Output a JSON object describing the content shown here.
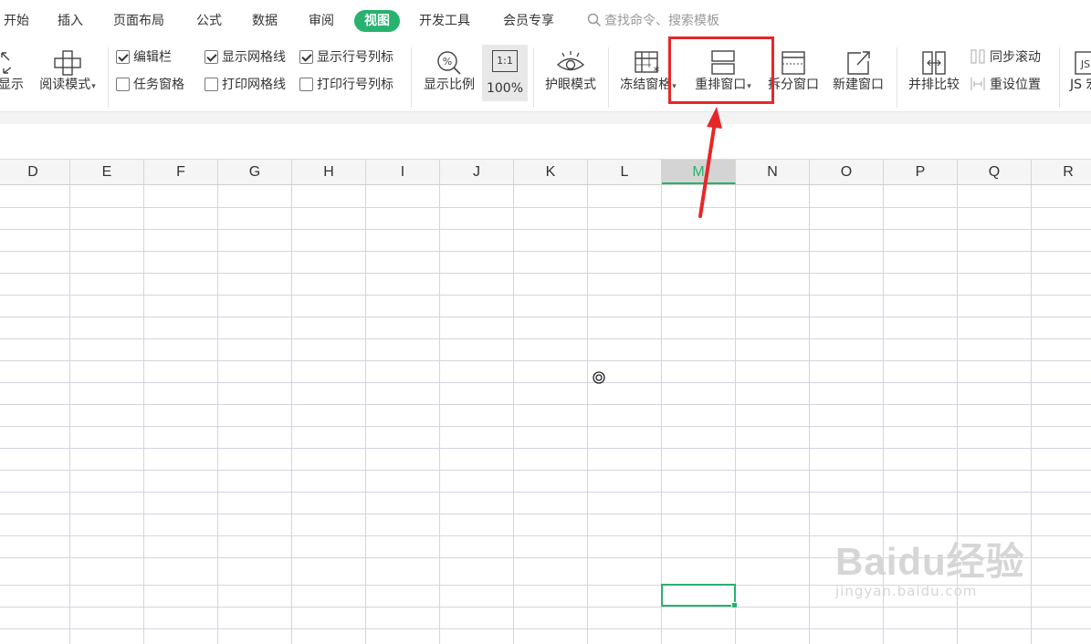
{
  "menu": {
    "tabs": [
      "开始",
      "插入",
      "页面布局",
      "公式",
      "数据",
      "审阅",
      "视图",
      "开发工具",
      "会员专享"
    ],
    "active": "视图",
    "search_placeholder": "查找命令、搜索模板"
  },
  "ribbon": {
    "display_label": "显示",
    "reading_mode_label": "阅读模式",
    "checkboxes": [
      {
        "label": "编辑栏",
        "checked": true
      },
      {
        "label": "任务窗格",
        "checked": false
      },
      {
        "label": "显示网格线",
        "checked": true
      },
      {
        "label": "打印网格线",
        "checked": false
      },
      {
        "label": "显示行号列标",
        "checked": true
      },
      {
        "label": "打印行号列标",
        "checked": false
      }
    ],
    "zoom_label": "显示比例",
    "zoom_icon_text": "1:1",
    "zoom_100_label": "100%",
    "eye_mode_label": "护眼模式",
    "freeze_label": "冻结窗格",
    "arrange_label": "重排窗口",
    "split_label": "拆分窗口",
    "new_window_label": "新建窗口",
    "side_by_side_label": "并排比较",
    "sync_scroll_label": "同步滚动",
    "reset_position_label": "重设位置",
    "js_label": "JS 宏"
  },
  "sheet": {
    "columns": [
      "D",
      "E",
      "F",
      "G",
      "H",
      "I",
      "J",
      "K",
      "L",
      "M",
      "N",
      "O",
      "P",
      "Q",
      "R"
    ],
    "selected_column": "M"
  },
  "watermark": {
    "brand": "Baidu经验",
    "url": "jingyan.baidu.com"
  },
  "colors": {
    "accent": "#27b26e",
    "highlight": "#e62727"
  }
}
